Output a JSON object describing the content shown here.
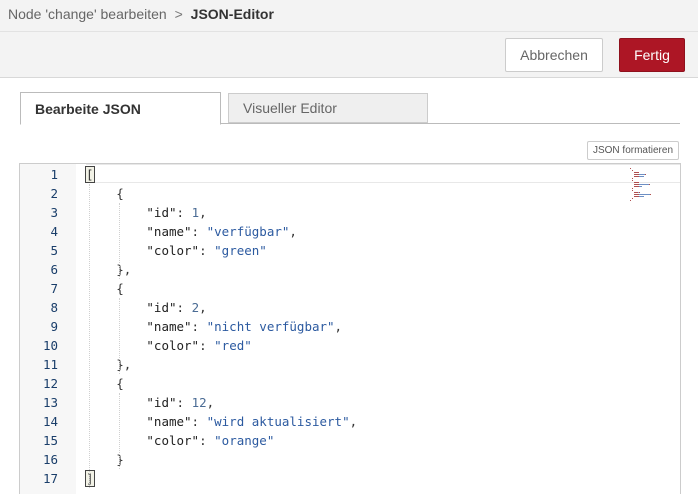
{
  "breadcrumb": {
    "parent": "Node 'change' bearbeiten",
    "separator": ">",
    "current": "JSON-Editor"
  },
  "toolbar": {
    "cancel_label": "Abbrechen",
    "done_label": "Fertig",
    "done_color": "#ad1625"
  },
  "tabs": [
    {
      "label": "Bearbeite JSON",
      "active": true
    },
    {
      "label": "Visueller Editor",
      "active": false
    }
  ],
  "format_button_label": "JSON formatieren",
  "editor": {
    "line_numbers": [
      "1",
      "2",
      "3",
      "4",
      "5",
      "6",
      "7",
      "8",
      "9",
      "10",
      "11",
      "12",
      "13",
      "14",
      "15",
      "16",
      "17"
    ],
    "lines": [
      {
        "indent": 0,
        "parts": [
          [
            "p",
            "["
          ]
        ]
      },
      {
        "indent": 1,
        "parts": [
          [
            "p",
            "{"
          ]
        ]
      },
      {
        "indent": 2,
        "parts": [
          [
            "k",
            "\"id\""
          ],
          [
            "p",
            ": "
          ],
          [
            "n",
            "1"
          ],
          [
            "p",
            ","
          ]
        ]
      },
      {
        "indent": 2,
        "parts": [
          [
            "k",
            "\"name\""
          ],
          [
            "p",
            ": "
          ],
          [
            "s",
            "\"verfügbar\""
          ],
          [
            "p",
            ","
          ]
        ]
      },
      {
        "indent": 2,
        "parts": [
          [
            "k",
            "\"color\""
          ],
          [
            "p",
            ": "
          ],
          [
            "s",
            "\"green\""
          ]
        ]
      },
      {
        "indent": 1,
        "parts": [
          [
            "p",
            "},"
          ]
        ]
      },
      {
        "indent": 1,
        "parts": [
          [
            "p",
            "{"
          ]
        ]
      },
      {
        "indent": 2,
        "parts": [
          [
            "k",
            "\"id\""
          ],
          [
            "p",
            ": "
          ],
          [
            "n",
            "2"
          ],
          [
            "p",
            ","
          ]
        ]
      },
      {
        "indent": 2,
        "parts": [
          [
            "k",
            "\"name\""
          ],
          [
            "p",
            ": "
          ],
          [
            "s",
            "\"nicht verfügbar\""
          ],
          [
            "p",
            ","
          ]
        ]
      },
      {
        "indent": 2,
        "parts": [
          [
            "k",
            "\"color\""
          ],
          [
            "p",
            ": "
          ],
          [
            "s",
            "\"red\""
          ]
        ]
      },
      {
        "indent": 1,
        "parts": [
          [
            "p",
            "},"
          ]
        ]
      },
      {
        "indent": 1,
        "parts": [
          [
            "p",
            "{"
          ]
        ]
      },
      {
        "indent": 2,
        "parts": [
          [
            "k",
            "\"id\""
          ],
          [
            "p",
            ": "
          ],
          [
            "n",
            "12"
          ],
          [
            "p",
            ","
          ]
        ]
      },
      {
        "indent": 2,
        "parts": [
          [
            "k",
            "\"name\""
          ],
          [
            "p",
            ": "
          ],
          [
            "s",
            "\"wird aktualisiert\""
          ],
          [
            "p",
            ","
          ]
        ]
      },
      {
        "indent": 2,
        "parts": [
          [
            "k",
            "\"color\""
          ],
          [
            "p",
            ": "
          ],
          [
            "s",
            "\"orange\""
          ]
        ]
      },
      {
        "indent": 1,
        "parts": [
          [
            "p",
            "}"
          ]
        ]
      },
      {
        "indent": 0,
        "parts": [
          [
            "p",
            "]"
          ]
        ]
      }
    ]
  }
}
